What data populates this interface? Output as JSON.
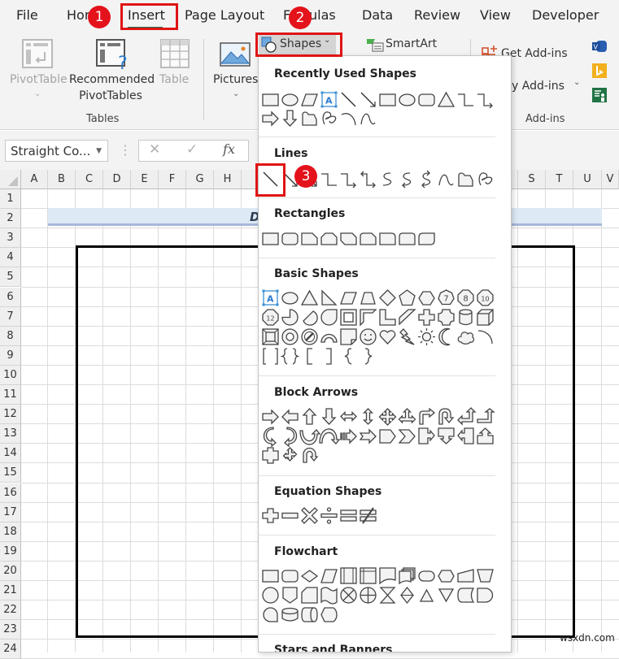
{
  "ribbon": {
    "tabs": [
      {
        "label": "File"
      },
      {
        "label": "Hom"
      },
      {
        "label": "Insert",
        "active": true
      },
      {
        "label": "Page Layout"
      },
      {
        "label": "F"
      },
      {
        "label": "ulas"
      },
      {
        "label": "Data"
      },
      {
        "label": "Review"
      },
      {
        "label": "View"
      },
      {
        "label": "Developer"
      }
    ],
    "groups": {
      "tables": {
        "label": "Tables",
        "pivottable": "PivotTable",
        "recommended_line1": "Recommended",
        "recommended_line2": "PivotTables",
        "table": "Table"
      },
      "illustrations": {
        "pictures": "Pictures",
        "shapes": "Shapes",
        "smartart": "SmartArt"
      },
      "addins": {
        "label": "Add-ins",
        "get_addins": "Get Add-ins",
        "my_addins": "y Add-ins"
      }
    },
    "accent_color": "#1e7145"
  },
  "formula_bar": {
    "name_box": "Straight Co...",
    "cancel_icon": "✕",
    "enter_icon": "✓",
    "fx_label": "fx"
  },
  "sheet": {
    "columns": [
      "A",
      "B",
      "C",
      "D",
      "E",
      "F",
      "G",
      "H",
      "S",
      "T",
      "U"
    ],
    "rows": [
      "1",
      "2",
      "3",
      "4",
      "5",
      "6",
      "7",
      "8",
      "9",
      "10",
      "11",
      "12",
      "13",
      "14",
      "15",
      "16",
      "17",
      "18",
      "19",
      "20",
      "21",
      "22",
      "23",
      "24"
    ],
    "title_fragment": "D",
    "watermark": "wsxdn.com"
  },
  "shapes_menu": {
    "sections": [
      {
        "title": "Recently Used Shapes"
      },
      {
        "title": "Lines"
      },
      {
        "title": "Rectangles"
      },
      {
        "title": "Basic Shapes"
      },
      {
        "title": "Block Arrows"
      },
      {
        "title": "Equation Shapes"
      },
      {
        "title": "Flowchart"
      },
      {
        "title": "Stars and Banners"
      }
    ],
    "octagon_numbers": [
      "7",
      "8",
      "10",
      "12"
    ],
    "textbox_glyph": "A"
  },
  "annotations": {
    "step1": "1",
    "step2": "2",
    "step3": "3",
    "highlight_color": "#e01414"
  }
}
